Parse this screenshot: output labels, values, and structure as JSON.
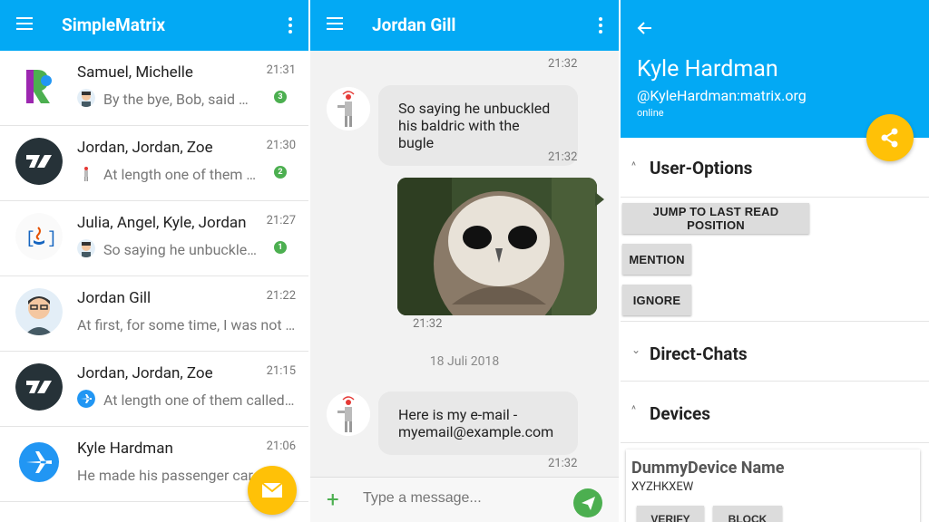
{
  "colors": {
    "primary": "#03a9f4",
    "accent": "#ffc107",
    "badge": "#4caf50"
  },
  "rooms_panel": {
    "app_title": "SimpleMatrix",
    "rooms": [
      {
        "name": "Samuel, Michelle",
        "time": "21:31",
        "preview": "By the bye, Bob, said …",
        "unread": "3",
        "avatar": "matrix-logo-icon",
        "sender": "avatar-face-icon"
      },
      {
        "name": "Jordan, Jordan, Zoe",
        "time": "21:30",
        "preview": "At length one of them …",
        "unread": "2",
        "avatar": "riot-logo-icon",
        "sender": "robot-icon"
      },
      {
        "name": "Julia, Angel, Kyle, Jordan",
        "time": "21:27",
        "preview": "So saying he unbuckle…",
        "unread": "1",
        "avatar": "java-logo-icon",
        "sender": "avatar-face-icon"
      },
      {
        "name": "Jordan Gill",
        "time": "21:22",
        "preview": "At first, for some time, I was not …",
        "unread": "",
        "avatar": "avatar-face-icon",
        "sender": ""
      },
      {
        "name": "Jordan, Jordan, Zoe",
        "time": "21:15",
        "preview": "At length one of them called…",
        "unread": "",
        "avatar": "riot-logo-icon",
        "sender": "airplane-icon"
      },
      {
        "name": "Kyle Hardman",
        "time": "21:06",
        "preview": "He made his passenger car",
        "unread": "",
        "avatar": "airplane-icon",
        "sender": ""
      }
    ]
  },
  "chat_panel": {
    "title": "Jordan Gill",
    "messages": [
      {
        "time_top": "21:32"
      },
      {
        "text": "So saying he unbuckled his baldric with the bugle",
        "time": "21:32"
      },
      {
        "image": "owl-photo",
        "time": "21:32"
      },
      {
        "date": "18 Juli 2018"
      },
      {
        "text": "Here is my e-mail - myemail@example.com",
        "time": "21:32"
      }
    ],
    "composer_placeholder": "Type a message..."
  },
  "user_panel": {
    "name": "Kyle Hardman",
    "user_id": "@KyleHardman:matrix.org",
    "presence": "online",
    "sections": {
      "options": "User-Options",
      "direct": "Direct-Chats",
      "devices": "Devices"
    },
    "buttons": {
      "jump": "JUMP TO LAST READ POSITION",
      "mention": "MENTION",
      "ignore": "IGNORE"
    },
    "device": {
      "name": "DummyDevice Name",
      "id": "XYZHKXEW",
      "verify": "VERIFY",
      "block": "BLOCK"
    }
  }
}
